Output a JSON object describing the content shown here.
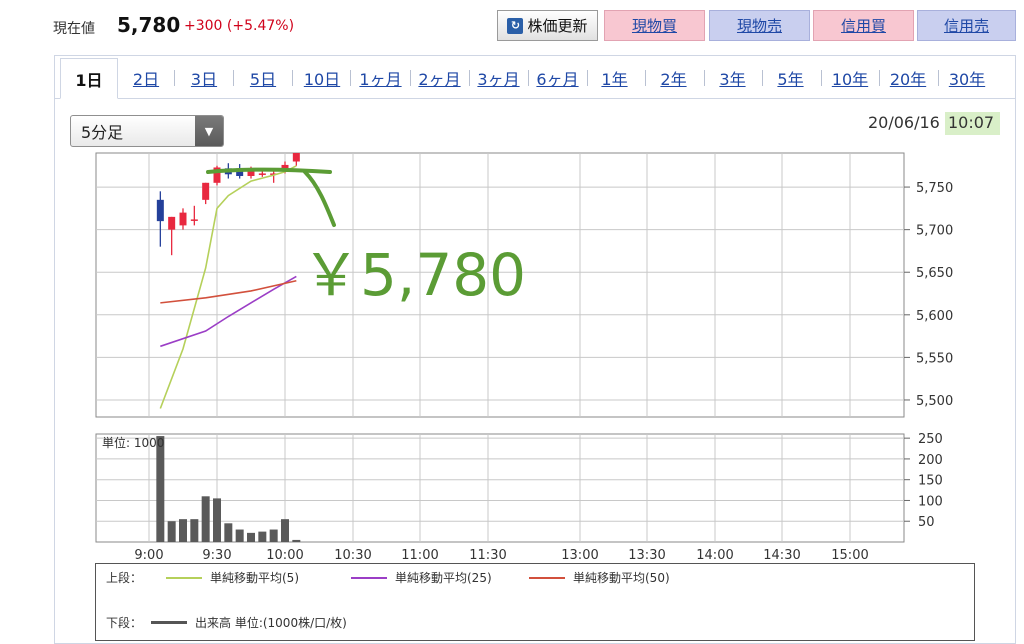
{
  "header": {
    "current_label": "現在値",
    "current_price": "5,780",
    "change": "+300 (+5.47%)",
    "refresh_label": "株価更新",
    "buttons": [
      "現物買",
      "現物売",
      "信用買",
      "信用売"
    ]
  },
  "tabs": [
    "1日",
    "2日",
    "3日",
    "5日",
    "10日",
    "1ヶ月",
    "2ヶ月",
    "3ヶ月",
    "6ヶ月",
    "1年",
    "2年",
    "3年",
    "5年",
    "10年",
    "20年",
    "30年"
  ],
  "active_tab": "1日",
  "interval_select": "5分足",
  "date": "20/06/16",
  "time": "10:07",
  "annotation": "￥5,780",
  "colors": {
    "up_candle": "#e8283f",
    "down_candle": "#24409a",
    "ma5": "#b5d05a",
    "ma25": "#9b3ec6",
    "ma50": "#d2503c",
    "volume": "#5a5a5a",
    "annotation": "#5b9c35"
  },
  "chart_data": [
    {
      "type": "candlestick",
      "interval": "5分足",
      "ylim": [
        5480,
        5790
      ],
      "yticks": [
        5500,
        5550,
        5600,
        5650,
        5700,
        5750
      ],
      "ytick_labels": [
        "5,500",
        "5,550",
        "5,600",
        "5,650",
        "5,700",
        "5,750"
      ],
      "x_labels": [
        "9:00",
        "9:30",
        "10:00",
        "10:30",
        "11:00",
        "11:30",
        "13:00",
        "13:30",
        "14:00",
        "14:30",
        "15:00"
      ],
      "candles": [
        {
          "time": "9:05",
          "open": 5735,
          "high": 5745,
          "low": 5680,
          "close": 5710
        },
        {
          "time": "9:10",
          "open": 5700,
          "high": 5715,
          "low": 5670,
          "close": 5715
        },
        {
          "time": "9:15",
          "open": 5705,
          "high": 5725,
          "low": 5700,
          "close": 5720
        },
        {
          "time": "9:20",
          "open": 5712,
          "high": 5728,
          "low": 5705,
          "close": 5712
        },
        {
          "time": "9:25",
          "open": 5735,
          "high": 5755,
          "low": 5730,
          "close": 5755
        },
        {
          "time": "9:30",
          "open": 5755,
          "high": 5775,
          "low": 5752,
          "close": 5773
        },
        {
          "time": "9:35",
          "open": 5772,
          "high": 5778,
          "low": 5760,
          "close": 5765
        },
        {
          "time": "9:40",
          "open": 5772,
          "high": 5777,
          "low": 5760,
          "close": 5763
        },
        {
          "time": "9:45",
          "open": 5763,
          "high": 5774,
          "low": 5760,
          "close": 5772
        },
        {
          "time": "9:50",
          "open": 5766,
          "high": 5770,
          "low": 5762,
          "close": 5766
        },
        {
          "time": "9:55",
          "open": 5766,
          "high": 5772,
          "low": 5755,
          "close": 5766
        },
        {
          "time": "10:00",
          "open": 5770,
          "high": 5780,
          "low": 5766,
          "close": 5776
        },
        {
          "time": "10:05",
          "open": 5780,
          "high": 5790,
          "low": 5775,
          "close": 5790
        }
      ],
      "series": [
        {
          "name": "単純移動平均(5)",
          "values": [
            [
              0,
              5490
            ],
            [
              2,
              5560
            ],
            [
              4,
              5655
            ],
            [
              5,
              5725
            ],
            [
              6,
              5740
            ],
            [
              8,
              5757
            ],
            [
              10,
              5764
            ],
            [
              11,
              5768
            ],
            [
              12,
              5775
            ]
          ]
        },
        {
          "name": "単純移動平均(25)",
          "values": [
            [
              0,
              5563
            ],
            [
              4,
              5581
            ],
            [
              6,
              5598
            ],
            [
              10,
              5630
            ],
            [
              12,
              5645
            ]
          ]
        },
        {
          "name": "単純移動平均(50)",
          "values": [
            [
              0,
              5614
            ],
            [
              4,
              5620
            ],
            [
              8,
              5628
            ],
            [
              12,
              5640
            ]
          ]
        }
      ]
    },
    {
      "type": "bar",
      "title": "単位: 1000",
      "ylim": [
        0,
        260
      ],
      "yticks": [
        50,
        100,
        150,
        200,
        250
      ],
      "ytick_labels": [
        "50",
        "100",
        "150",
        "200",
        "250"
      ],
      "categories": [
        "9:05",
        "9:10",
        "9:15",
        "9:20",
        "9:25",
        "9:30",
        "9:35",
        "9:40",
        "9:45",
        "9:50",
        "9:55",
        "10:00",
        "10:05"
      ],
      "values": [
        255,
        50,
        55,
        55,
        110,
        105,
        45,
        30,
        22,
        25,
        30,
        55,
        5
      ]
    }
  ],
  "legend": {
    "upper_label": "上段：",
    "lower_label": "下段：",
    "items": [
      "単純移動平均(5)",
      "単純移動平均(25)",
      "単純移動平均(50)"
    ],
    "volume_label": "出来高 単位:(1000株/口/枚)"
  }
}
